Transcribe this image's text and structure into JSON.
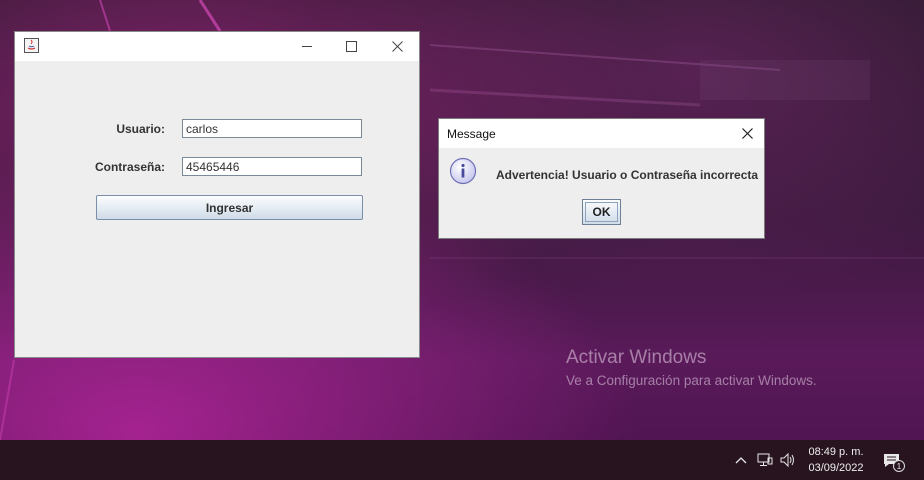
{
  "login_window": {
    "user_label": "Usuario:",
    "user_value": "carlos",
    "password_label": "Contraseña:",
    "password_value": "45465446",
    "submit_label": "Ingresar",
    "icons": {
      "app": "java-icon",
      "minimize": "minimize-icon",
      "maximize": "maximize-icon",
      "close": "close-icon"
    }
  },
  "message_dialog": {
    "title": "Message",
    "message": "Advertencia! Usuario o Contraseña incorrecta",
    "ok_label": "OK",
    "icons": {
      "info": "info-icon",
      "close": "close-icon"
    }
  },
  "watermark": {
    "title": "Activar Windows",
    "subtitle": "Ve a Configuración para activar Windows."
  },
  "taskbar": {
    "time": "08:49 p. m.",
    "date": "03/09/2022",
    "notification_count": "1",
    "icons": {
      "chevron": "chevron-up-icon",
      "network": "network-icon",
      "volume": "volume-icon",
      "notifications": "action-center-icon"
    }
  }
}
